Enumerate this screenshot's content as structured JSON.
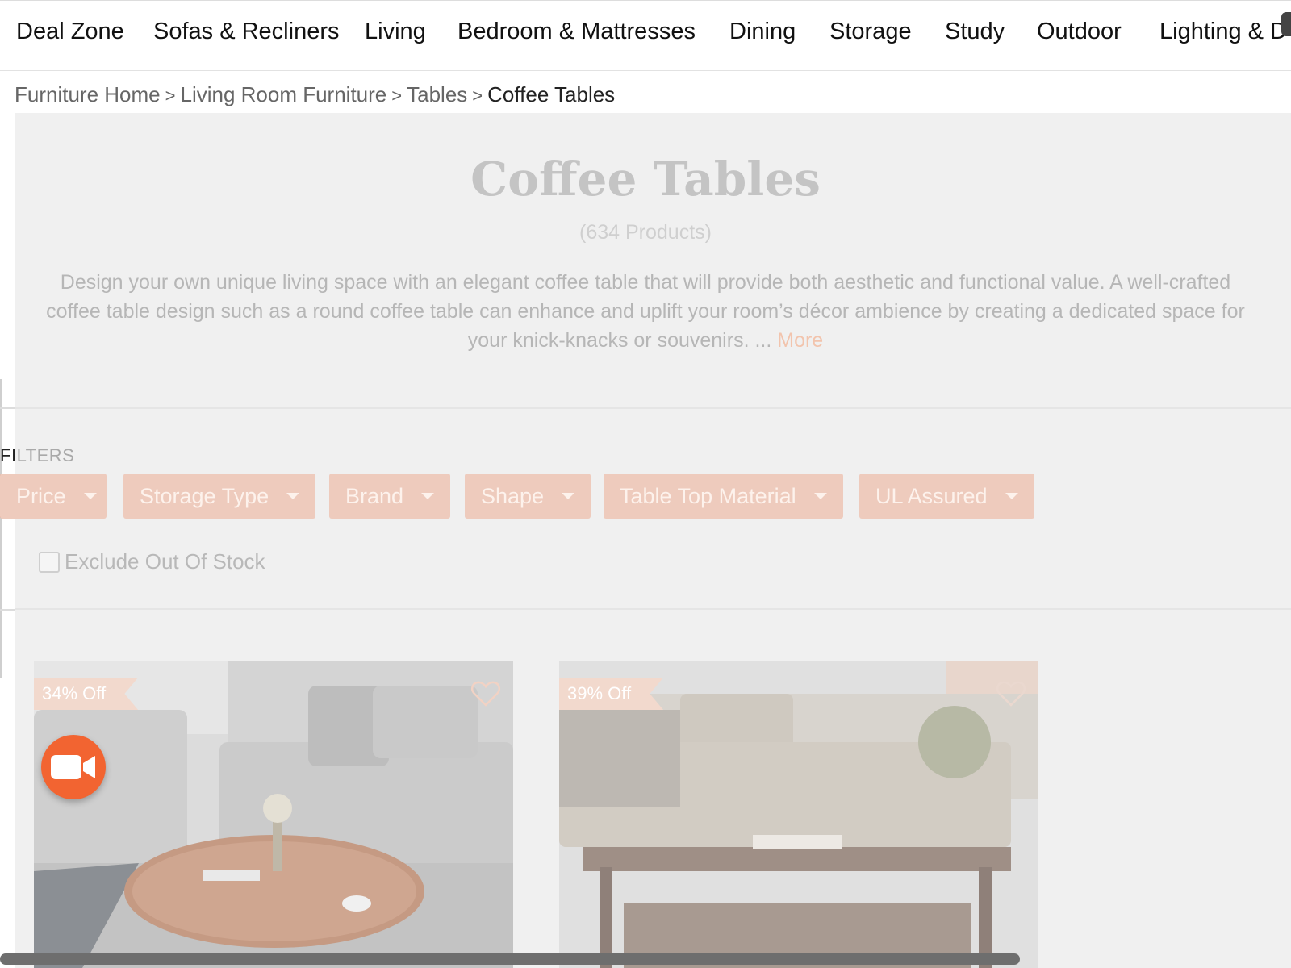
{
  "topnav": {
    "items": [
      "Deal Zone",
      "Sofas & Recliners",
      "Living",
      "Bedroom & Mattresses",
      "Dining",
      "Storage",
      "Study",
      "Outdoor",
      "Lighting & D"
    ]
  },
  "breadcrumb": {
    "items": [
      "Furniture Home",
      "Living Room Furniture",
      "Tables"
    ],
    "separator": ">",
    "current": "Coffee Tables"
  },
  "hero": {
    "title": "Coffee Tables",
    "count": "(634 Products)",
    "description": "Design your own unique living space with an elegant coffee table that will provide both aesthetic and functional value. A well-crafted coffee table design such as a round coffee table can enhance and uplift your room’s décor ambience by creating a dedicated space for your knick-knacks or souvenirs. ... ",
    "more_label": "More"
  },
  "filters": {
    "label_visible": "FI",
    "label_dim": "LTERS",
    "buttons": [
      "Price",
      "Storage Type",
      "Brand",
      "Shape",
      "Table Top Material",
      "UL Assured"
    ],
    "exclude_label": "Exclude Out Of Stock",
    "exclude_checked": false
  },
  "products": [
    {
      "discount": "34% Off"
    },
    {
      "discount": "39% Off"
    }
  ],
  "colors": {
    "accent": "#e85f2a",
    "video_button": "#f26431",
    "filter_button": "#eecbbd",
    "overlay_bg": "#f0f0f0"
  },
  "icons": {
    "video": "video-camera-icon",
    "wishlist": "heart-icon",
    "filter_caret": "caret-down-icon"
  }
}
